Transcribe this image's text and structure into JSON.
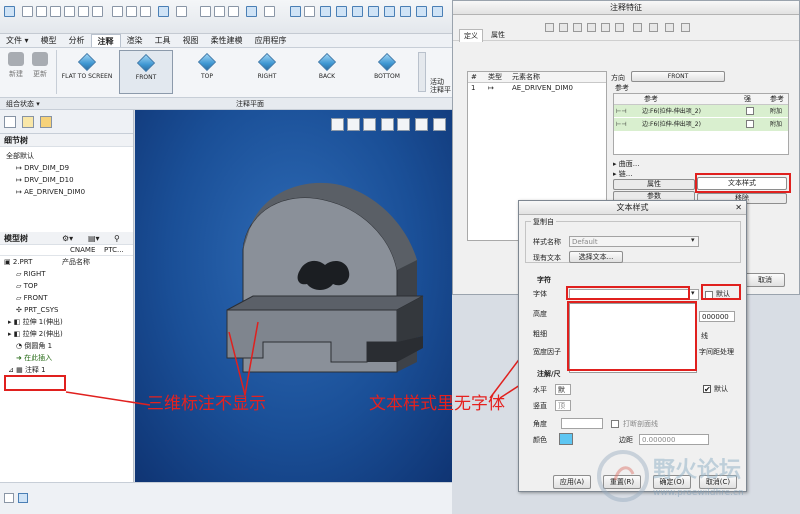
{
  "menu_tabs": [
    {
      "label": "文件 ▾",
      "active": false
    },
    {
      "label": "模型",
      "active": false
    },
    {
      "label": "分析",
      "active": false
    },
    {
      "label": "注释",
      "active": true
    },
    {
      "label": "渲染",
      "active": false
    },
    {
      "label": "工具",
      "active": false
    },
    {
      "label": "视图",
      "active": false
    },
    {
      "label": "柔性建模",
      "active": false
    },
    {
      "label": "应用程序",
      "active": false
    }
  ],
  "ribbon": {
    "new_label": "新建",
    "update_label": "更新",
    "orientations": [
      "FLAT TO SCREEN",
      "FRONT",
      "TOP",
      "RIGHT",
      "BACK",
      "BOTTOM"
    ],
    "activate_label": "活动",
    "annot_plane_label": "注释平",
    "group_state_label": "组合状态 ▾",
    "group_plane_label": "注释平面"
  },
  "sidebar": {
    "detail_tree_title": "细节树",
    "detail_root": "全部默认",
    "detail_items": [
      "DRV_DIM_D9",
      "DRV_DIM_D10",
      "AE_DRIVEN_DIM0"
    ],
    "model_tree_title": "模型树",
    "col_cname": "CNAME",
    "col_ptc": "PTC...",
    "part_name": "2.PRT",
    "part_name_col": "产品名称",
    "model_items": [
      "RIGHT",
      "TOP",
      "FRONT",
      "PRT_CSYS",
      "拉伸 1(伸出)",
      "拉伸 2(伸出)",
      "倒圆角 1",
      "在此插入",
      "注释 1"
    ]
  },
  "annot_panel": {
    "title": "注释特征",
    "tab_define": "定义",
    "tab_properties": "属性",
    "col_num": "#",
    "col_type": "类型",
    "col_element": "元素名称",
    "row_num": "1",
    "row_element": "AE_DRIVEN_DIM0",
    "direction_label": "方向",
    "direction_value": "FRONT",
    "ref_label": "参考",
    "ref_col_ref": "参考",
    "ref_col_strong": "强",
    "ref_col_attach": "参考",
    "ref_rows": [
      {
        "text": "边:F6(拉伸-伸出项_2)",
        "attach": "附加"
      },
      {
        "text": "边:F6(拉伸-伸出项_2)",
        "attach": "附加"
      }
    ],
    "surface_label": "曲面...",
    "chain_label": "链...",
    "tab_attr": "属性",
    "tab_text_style": "文本样式",
    "tab_param": "参数",
    "tab_move": "移除",
    "cancel_label": "取消"
  },
  "text_style_dialog": {
    "title": "文本样式",
    "copy_from": "复制自",
    "style_name_label": "样式名称",
    "style_name_value": "Default",
    "existing_text_label": "现有文本",
    "select_text_button": "选择文本...",
    "char_section": "字符",
    "font_label": "字体",
    "default_label": "默认",
    "height_label": "高度",
    "height_value": "000000",
    "thickness_label": "粗细",
    "width_factor_label": "宽度因子",
    "underline_label": "线",
    "kerning_label": "字间距处理",
    "note_section": "注解/尺",
    "horiz_label": "水平",
    "horiz_value": "默",
    "vert_label": "竖直",
    "vert_value": "顶",
    "default2_label": "默认",
    "angle_label": "角度",
    "break_hatch_label": "打断剖面线",
    "color_label": "颜色",
    "margin_label": "边距",
    "margin_value": "0.000000",
    "apply_button": "应用(A)",
    "reset_button": "重置(R)",
    "ok_button": "确定(O)",
    "cancel_button": "取消(C)",
    "color_value": "#5ec6f2"
  },
  "annotations": {
    "left_text": "三维标注不显示",
    "right_text": "文本样式里无字体",
    "red_color": "#e0201e"
  },
  "watermark": {
    "name": "野火论坛",
    "url": "www.proewildfire.cn"
  },
  "status": {
    "button_label": "▶"
  }
}
